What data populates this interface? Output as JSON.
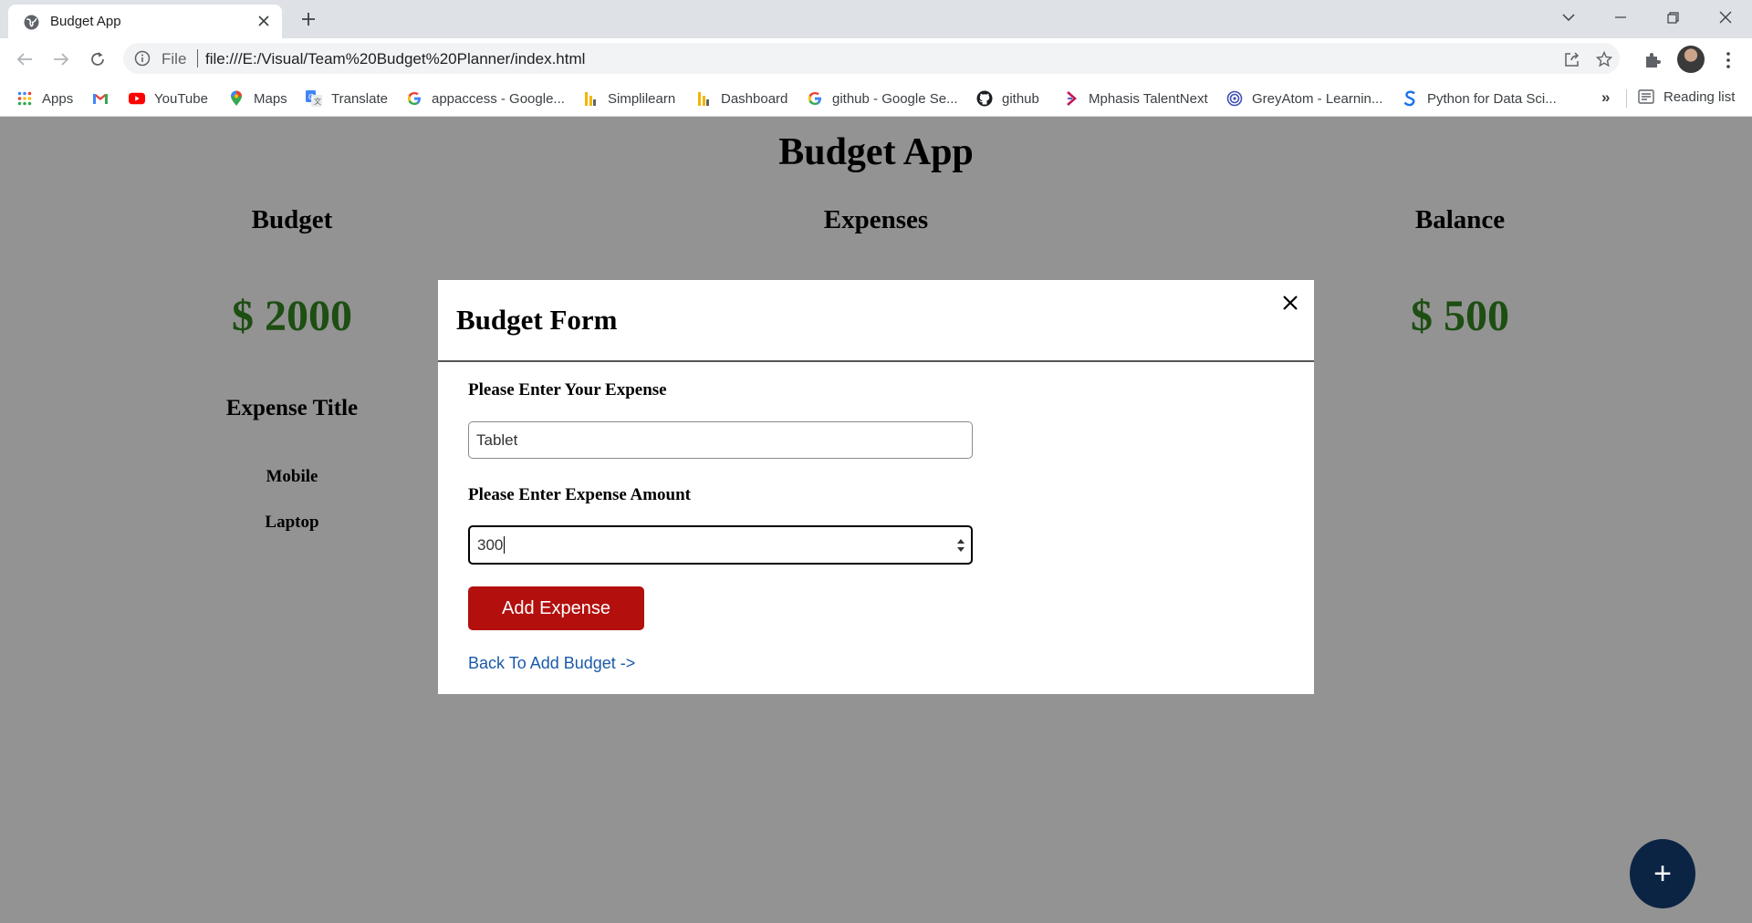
{
  "browser": {
    "tab_title": "Budget App",
    "omnibox": {
      "scheme_label": "File",
      "url": "file:///E:/Visual/Team%20Budget%20Planner/index.html"
    },
    "bookmarks": [
      {
        "label": "Apps",
        "icon": "apps-grid-icon"
      },
      {
        "label": "",
        "icon": "gmail-icon"
      },
      {
        "label": "YouTube",
        "icon": "youtube-icon"
      },
      {
        "label": "Maps",
        "icon": "maps-pin-icon"
      },
      {
        "label": "Translate",
        "icon": "translate-icon"
      },
      {
        "label": "appaccess - Google...",
        "icon": "google-icon"
      },
      {
        "label": "Simplilearn",
        "icon": "bar-chart-icon"
      },
      {
        "label": "Dashboard",
        "icon": "bar-chart-icon"
      },
      {
        "label": "github - Google Se...",
        "icon": "google-icon"
      },
      {
        "label": "github",
        "icon": "github-icon"
      },
      {
        "label": "Mphasis TalentNext",
        "icon": "mphasis-icon"
      },
      {
        "label": "GreyAtom - Learnin...",
        "icon": "greyatom-icon"
      },
      {
        "label": "Python for Data Sci...",
        "icon": "simplilearn-s-icon"
      }
    ],
    "bookmarks_overflow": "»",
    "reading_list": "Reading list"
  },
  "app": {
    "title": "Budget App",
    "columns": {
      "budget": {
        "label": "Budget",
        "amount": "$ 2000"
      },
      "expenses": {
        "label": "Expenses"
      },
      "balance": {
        "label": "Balance",
        "amount": "$ 500"
      }
    },
    "expense_list": {
      "title": "Expense Title",
      "items": [
        "Mobile",
        "Laptop"
      ]
    },
    "fab_label": "+"
  },
  "modal": {
    "title": "Budget Form",
    "expense_label": "Please Enter Your Expense",
    "expense_value": "Tablet",
    "amount_label": "Please Enter Expense Amount",
    "amount_value": "300",
    "submit_label": "Add Expense",
    "back_link": "Back To Add Budget ->"
  },
  "colors": {
    "overlay": "#939393",
    "amount_green": "#1d4e12",
    "button_red": "#b30f0d",
    "fab_navy": "#0b2444",
    "link_blue": "#1a5aa8"
  }
}
